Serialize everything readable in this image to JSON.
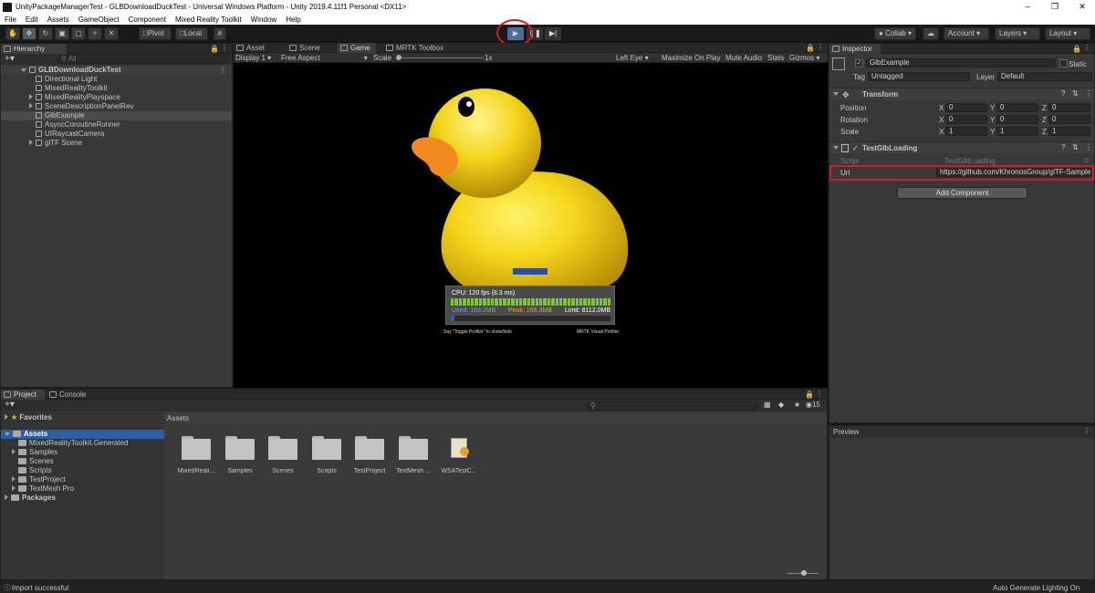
{
  "window": {
    "title": "UnityPackageManagerTest - GLBDownloadDuckTest - Universal Windows Platform - Unity 2019.4.11f1 Personal <DX11>"
  },
  "menu": [
    "File",
    "Edit",
    "Assets",
    "GameObject",
    "Component",
    "Mixed Reality Toolkit",
    "Window",
    "Help"
  ],
  "toolbar": {
    "pivot": "Pivot",
    "local": "Local",
    "collab": "Collab",
    "account": "Account",
    "layers": "Layers",
    "layout": "Layout"
  },
  "hierarchy": {
    "tab": "Hierarchy",
    "search_placeholder": "All",
    "scene": "GLBDownloadDuckTest",
    "items": [
      {
        "label": "Directional Light",
        "expandable": false
      },
      {
        "label": "MixedRealityToolkit",
        "expandable": false
      },
      {
        "label": "MixedRealityPlayspace",
        "expandable": true
      },
      {
        "label": "SceneDescriptionPanelRev",
        "expandable": true
      },
      {
        "label": "GlbExample",
        "expandable": false,
        "selected": true
      },
      {
        "label": "AsyncCoroutineRunner",
        "expandable": false
      },
      {
        "label": "UIRaycastCamera",
        "expandable": false
      },
      {
        "label": "glTF Scene",
        "expandable": true
      }
    ]
  },
  "center_tabs": [
    "Asset Store",
    "Scene",
    "Game",
    "MRTK Toolbox"
  ],
  "game_bar": {
    "display": "Display 1",
    "aspect": "Free Aspect",
    "scale_label": "Scale",
    "scale_value": "1x",
    "eye": "Left Eye",
    "maximize": "Maximize On Play",
    "mute": "Mute Audio",
    "stats": "Stats",
    "gizmos": "Gizmos"
  },
  "profiler": {
    "cpu": "CPU: 120 fps (8.3 ms)",
    "used": "Used: 169.2MB",
    "peak": "Peak: 169.3MB",
    "limit": "Limit: 8112.0MB",
    "hint_left": "Say \"Toggle Profiler\" to show/hide",
    "hint_right": "MRTK Visual Profiler",
    "frame_fill": 1.0,
    "memory_fill": 0.02
  },
  "inspector": {
    "tab": "Inspector",
    "object_name": "GlbExample",
    "static_label": "Static",
    "tag_label": "Tag",
    "tag_value": "Untagged",
    "layer_label": "Layer",
    "layer_value": "Default",
    "transform": {
      "title": "Transform",
      "position": {
        "label": "Position",
        "x": "0",
        "y": "0",
        "z": "0"
      },
      "rotation": {
        "label": "Rotation",
        "x": "0",
        "y": "0",
        "z": "0"
      },
      "scale": {
        "label": "Scale",
        "x": "1",
        "y": "1",
        "z": "1"
      }
    },
    "component": {
      "title": "TestGlbLoading",
      "script_label": "Script",
      "script_value": "TestGlbLoading",
      "url_label": "Url",
      "url_value": "https://github.com/KhronosGroup/glTF-Sample-"
    },
    "add_component": "Add Component",
    "preview": "Preview"
  },
  "project": {
    "tabs": [
      "Project",
      "Console"
    ],
    "favorites": "Favorites",
    "assets_root": "Assets",
    "tree": [
      "MixedRealityToolkit.Generated",
      "Samples",
      "Scenes",
      "Scripts",
      "TestProject",
      "TextMesh Pro"
    ],
    "packages": "Packages",
    "count": "15",
    "breadcrumb": "Assets",
    "grid": [
      "MixedReali...",
      "Samples",
      "Scenes",
      "Scripts",
      "TestProject",
      "TextMesh ...",
      "WSATestC..."
    ]
  },
  "status": {
    "left": "Import successful",
    "right": "Auto Generate Lighting On"
  },
  "colors": {
    "duck": "#f2d21a",
    "beak": "#f08a1e",
    "highlight": "#cc1f25",
    "selection": "#2d5ea3"
  }
}
